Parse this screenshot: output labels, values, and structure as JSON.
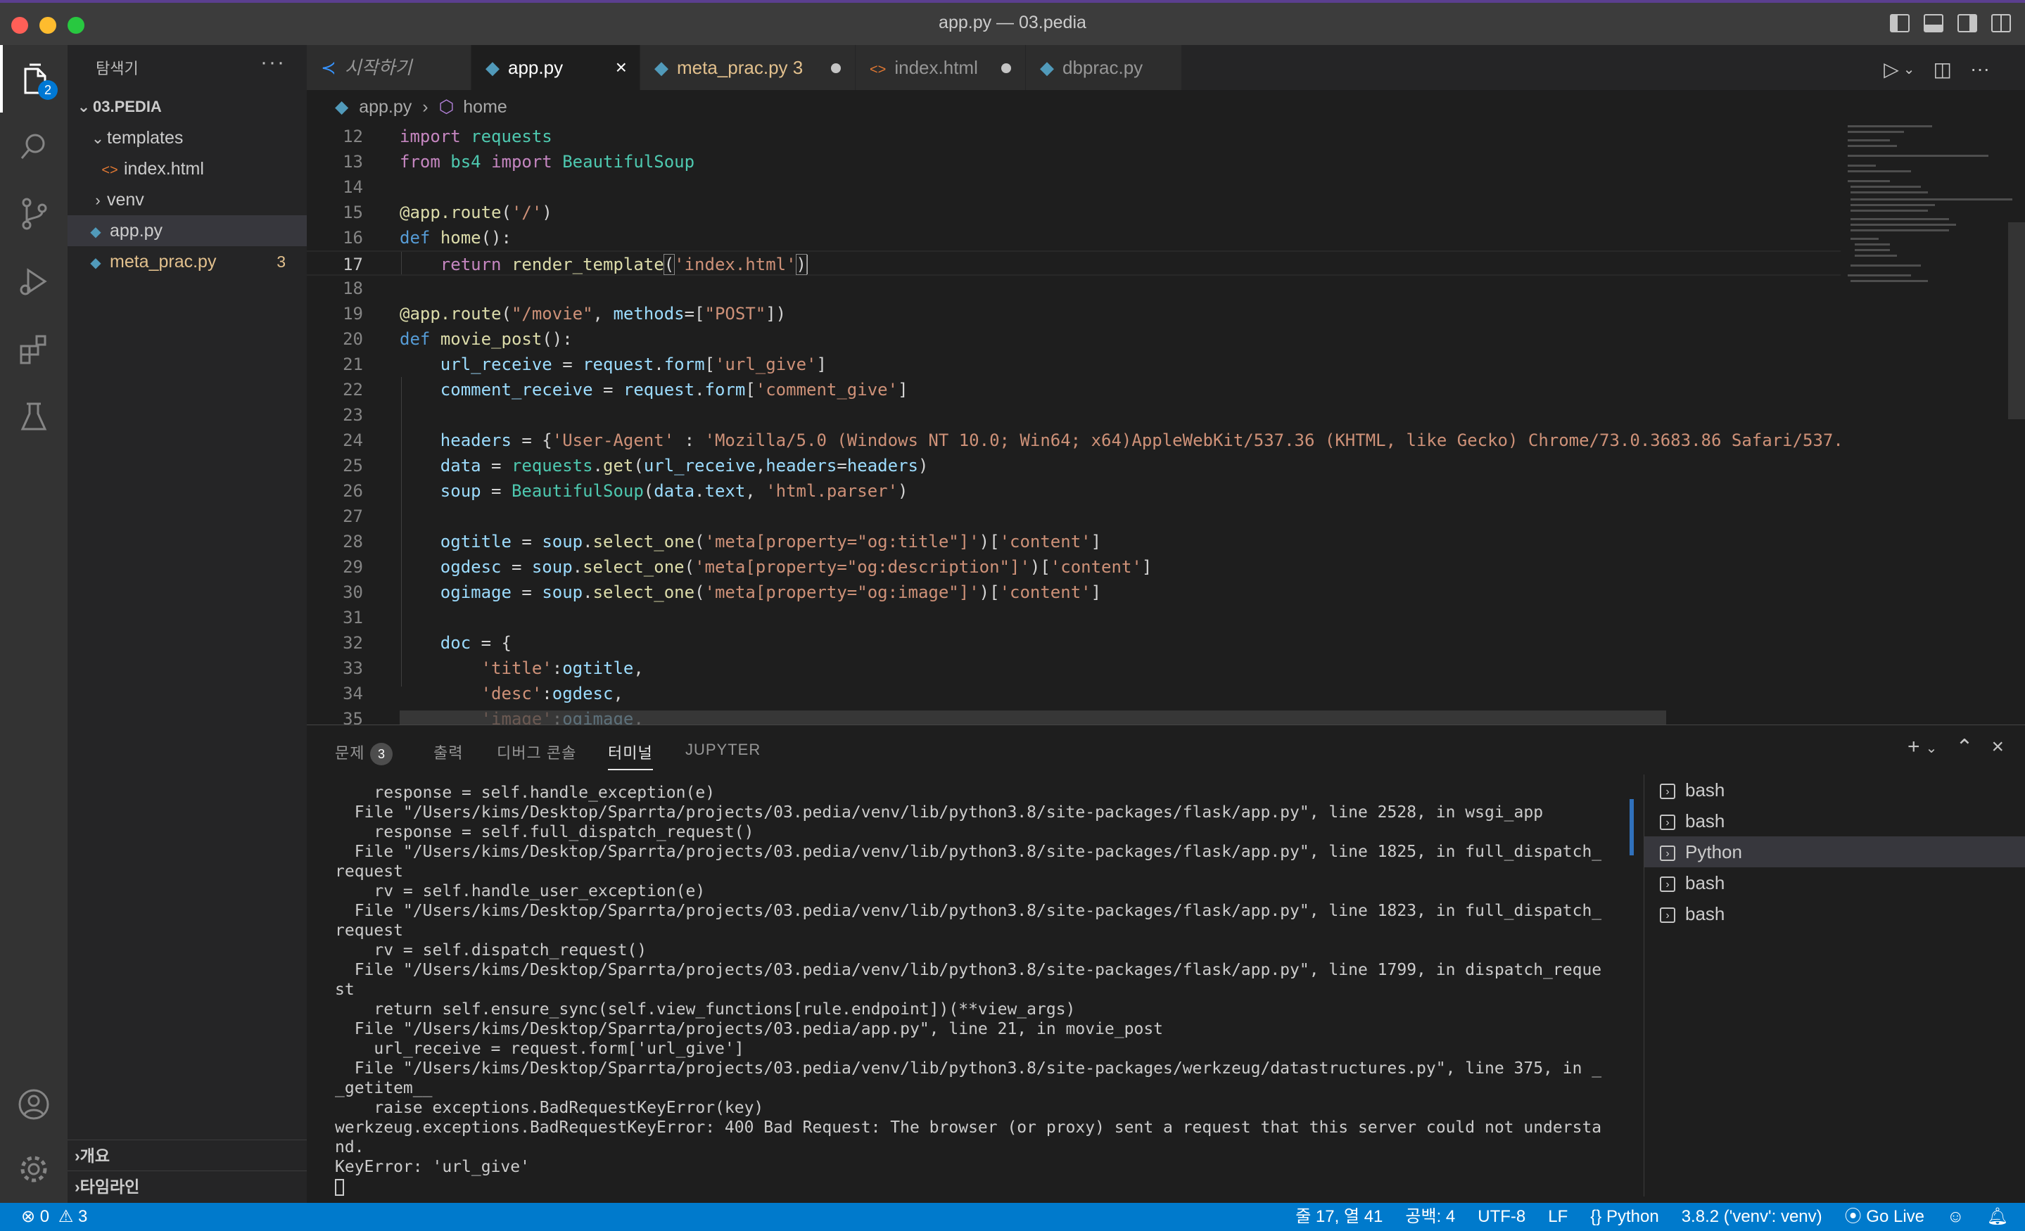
{
  "window": {
    "title": "app.py — 03.pedia"
  },
  "activity_bar": {
    "explorer_badge": "2"
  },
  "sidebar": {
    "title": "탐색기",
    "more": "···",
    "project": "03.PEDIA",
    "items": [
      {
        "label": "templates"
      },
      {
        "label": "index.html"
      },
      {
        "label": "venv"
      },
      {
        "label": "app.py"
      },
      {
        "label": "meta_prac.py",
        "count": "3"
      }
    ],
    "outline": "개요",
    "timeline": "타임라인"
  },
  "tabs": [
    {
      "label": "시작하기"
    },
    {
      "label": "app.py"
    },
    {
      "label": "meta_prac.py 3"
    },
    {
      "label": "index.html"
    },
    {
      "label": "dbprac.py"
    }
  ],
  "breadcrumb": {
    "file": "app.py",
    "symbol": "home"
  },
  "editor": {
    "line_numbers": [
      "12",
      "13",
      "14",
      "15",
      "16",
      "17",
      "18",
      "19",
      "20",
      "21",
      "22",
      "23",
      "24",
      "25",
      "26",
      "27",
      "28",
      "29",
      "30",
      "31",
      "32",
      "33",
      "34",
      "35"
    ]
  },
  "panel": {
    "tabs": [
      "문제",
      "출력",
      "디버그 콘솔",
      "터미널",
      "JUPYTER"
    ],
    "problems_count": "3",
    "terminal_lines": [
      "    response = self.handle_exception(e)",
      "  File \"/Users/kims/Desktop/Sparrta/projects/03.pedia/venv/lib/python3.8/site-packages/flask/app.py\", line 2528, in wsgi_app",
      "    response = self.full_dispatch_request()",
      "  File \"/Users/kims/Desktop/Sparrta/projects/03.pedia/venv/lib/python3.8/site-packages/flask/app.py\", line 1825, in full_dispatch_",
      "request",
      "    rv = self.handle_user_exception(e)",
      "  File \"/Users/kims/Desktop/Sparrta/projects/03.pedia/venv/lib/python3.8/site-packages/flask/app.py\", line 1823, in full_dispatch_",
      "request",
      "    rv = self.dispatch_request()",
      "  File \"/Users/kims/Desktop/Sparrta/projects/03.pedia/venv/lib/python3.8/site-packages/flask/app.py\", line 1799, in dispatch_reque",
      "st",
      "    return self.ensure_sync(self.view_functions[rule.endpoint])(**view_args)",
      "  File \"/Users/kims/Desktop/Sparrta/projects/03.pedia/app.py\", line 21, in movie_post",
      "    url_receive = request.form['url_give']",
      "  File \"/Users/kims/Desktop/Sparrta/projects/03.pedia/venv/lib/python3.8/site-packages/werkzeug/datastructures.py\", line 375, in _",
      "_getitem__",
      "    raise exceptions.BadRequestKeyError(key)",
      "werkzeug.exceptions.BadRequestKeyError: 400 Bad Request: The browser (or proxy) sent a request that this server could not understa",
      "nd.",
      "KeyError: 'url_give'"
    ],
    "terminals": [
      "bash",
      "bash",
      "Python",
      "bash",
      "bash"
    ]
  },
  "status": {
    "errors": "0",
    "warnings": "3",
    "position": "줄 17, 열 41",
    "spaces": "공백: 4",
    "encoding": "UTF-8",
    "eol": "LF",
    "language": "Python",
    "interpreter": "3.8.2 ('venv': venv)",
    "golive": "Go Live"
  }
}
